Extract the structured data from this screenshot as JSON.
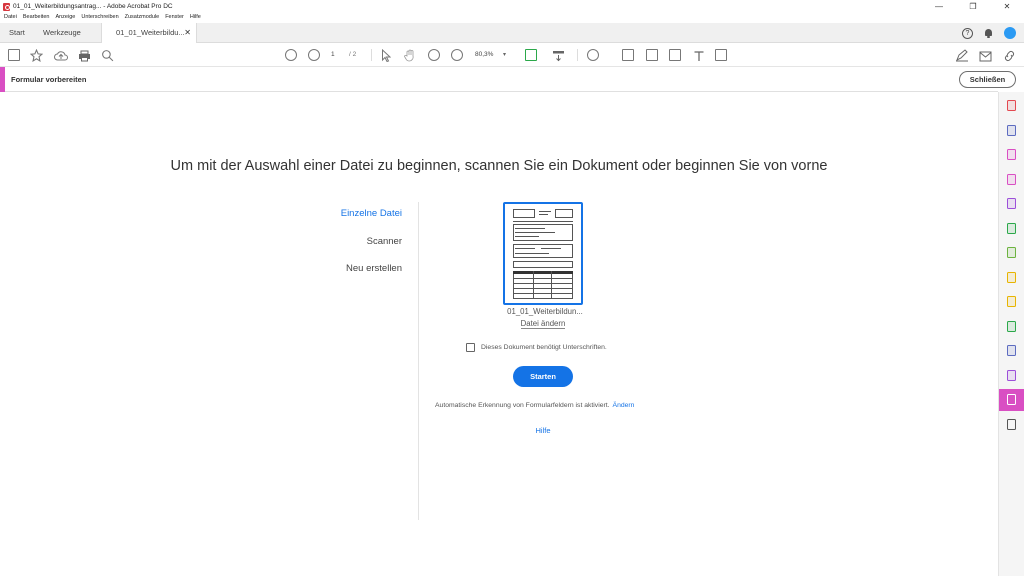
{
  "window": {
    "title": "01_01_Weiterbildungsantrag... - Adobe Acrobat Pro DC",
    "controls": {
      "minimize": "—",
      "restore": "❐",
      "close": "✕"
    }
  },
  "menu": [
    "Datei",
    "Bearbeiten",
    "Anzeige",
    "Unterschreiben",
    "Zusatzmodule",
    "Fenster",
    "Hilfe"
  ],
  "tabs": {
    "start": "Start",
    "tools": "Werkzeuge",
    "document": "01_01_Weiterbildu...",
    "close_glyph": "✕"
  },
  "top_right": {
    "help_glyph": "?"
  },
  "toolbar": {
    "page_current": "1",
    "page_total": "/ 2",
    "zoom": "80,3%",
    "zoom_arrow": "▾"
  },
  "formbar": {
    "title": "Formular vorbereiten",
    "close_label": "Schließen",
    "accent_color": "#d94fc3"
  },
  "main": {
    "headline": "Um mit der Auswahl einer Datei zu beginnen, scannen Sie ein Dokument oder beginnen Sie von vorne",
    "left_nav": [
      "Einzelne Datei",
      "Scanner",
      "Neu erstellen"
    ],
    "file_name": "01_01_Weiterbildun...",
    "change_file": "Datei ändern",
    "signature_checkbox_label": "Dieses Dokument benötigt Unterschriften.",
    "start_label": "Starten",
    "auto_detect_text": "Automatische Erkennung von Formularfeldern ist aktiviert.",
    "auto_detect_link": "Ändern",
    "help_label": "Hilfe",
    "accent_color": "#1473e6"
  },
  "rail": {
    "tool_colors": [
      "#e34850",
      "#5c6bc0",
      "#d94fc3",
      "#d94fc3",
      "#9c4fd9",
      "#2ba84a",
      "#6cb33f",
      "#e8b400",
      "#e8b400",
      "#2ba84a",
      "#5c6bc0",
      "#9c4fd9",
      "#d94fc3"
    ],
    "active_index": 12
  }
}
